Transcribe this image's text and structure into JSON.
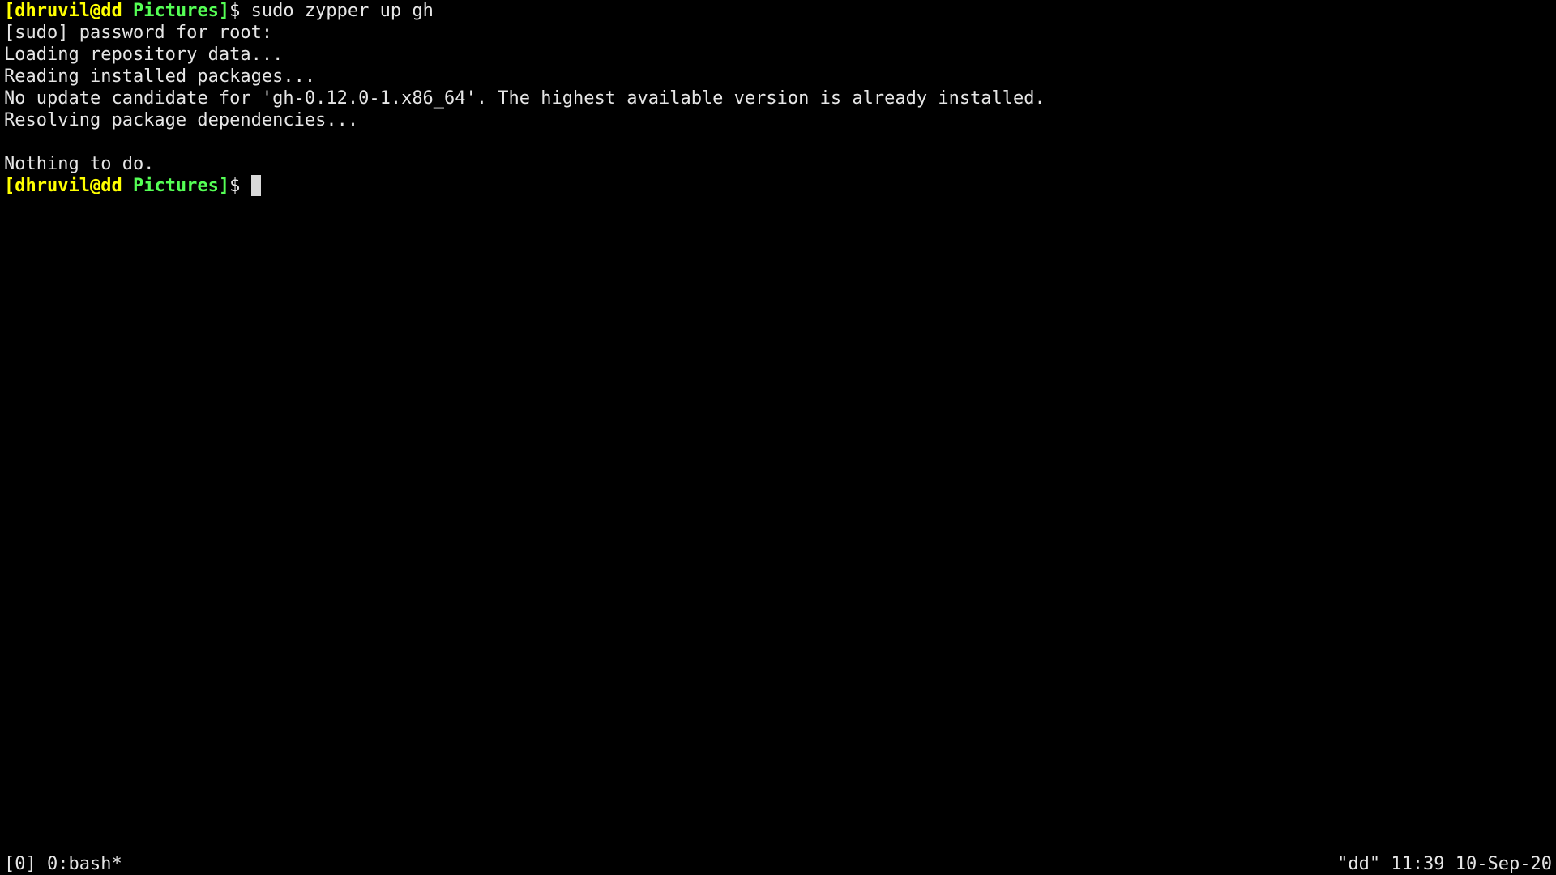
{
  "prompt": {
    "user_host": "[dhruvil@dd",
    "cwd": "Pictures]",
    "symbol": "$ "
  },
  "lines": [
    "sudo zypper up gh",
    "[sudo] password for root:",
    "Loading repository data...",
    "Reading installed packages...",
    "No update candidate for 'gh-0.12.0-1.x86_64'. The highest available version is already installed.",
    "Resolving package dependencies...",
    "",
    "Nothing to do."
  ],
  "status_bar": {
    "left": "[0] 0:bash*",
    "right": "\"dd\" 11:39 10-Sep-20"
  },
  "colors": {
    "background": "#000000",
    "text": "#e6e6e6",
    "user_host": "#ffff00",
    "cwd": "#55ff55",
    "cursor": "#d9d9d9"
  }
}
